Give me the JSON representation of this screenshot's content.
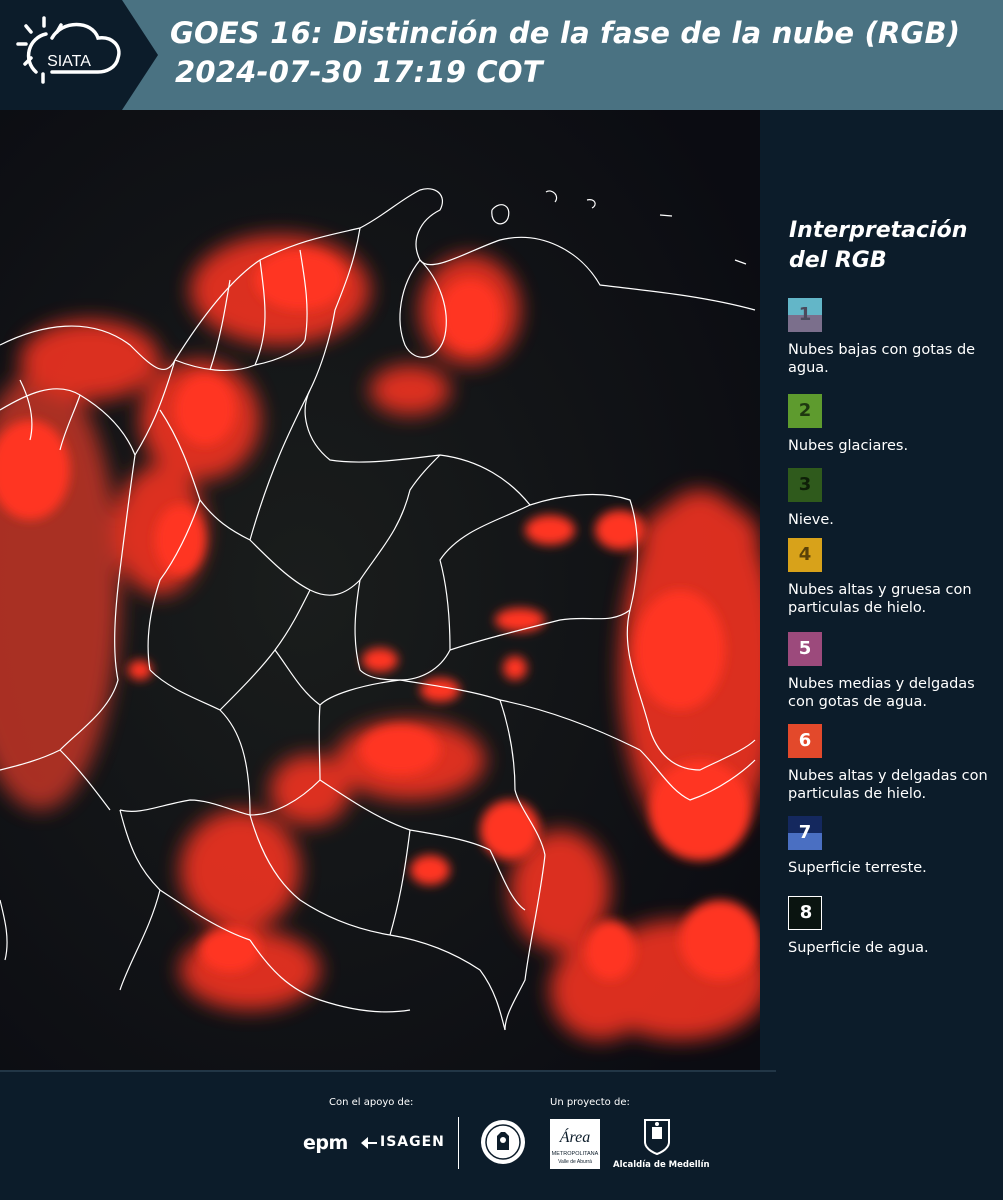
{
  "header": {
    "logo_text": "SIATA",
    "title_line1": "GOES 16: Distinción de la fase de la nube (RGB)",
    "title_line2": "2024-07-30 17:19 COT"
  },
  "legend": {
    "title": "Interpretación del RGB",
    "items": [
      {
        "number": "1",
        "label": "Nubes bajas con gotas de agua.",
        "color_top": "#63b6c8",
        "color_bottom": "#7b6f8c",
        "num_color": "#4a4a5c"
      },
      {
        "number": "2",
        "label": "Nubes glaciares.",
        "color_top": "#5e9b2e",
        "color_bottom": "#5e9b2e",
        "num_color": "#1e3810"
      },
      {
        "number": "3",
        "label": "Nieve.",
        "color_top": "#2f5a1c",
        "color_bottom": "#2f5a1c",
        "num_color": "#0e1f08"
      },
      {
        "number": "4",
        "label": "Nubes altas y gruesa con particulas de hielo.",
        "color_top": "#d8a21a",
        "color_bottom": "#d8a21a",
        "num_color": "#5b4208"
      },
      {
        "number": "5",
        "label": "Nubes medias y delgadas con gotas de agua.",
        "color_top": "#9c4a7c",
        "color_bottom": "#9c4a7c",
        "num_color": "#ffffff"
      },
      {
        "number": "6",
        "label": "Nubes altas y delgadas con particulas de hielo.",
        "color_top": "#e3492b",
        "color_bottom": "#e3492b",
        "num_color": "#ffffff"
      },
      {
        "number": "7",
        "label": "Superficie terreste.",
        "color_top": "#14285e",
        "color_bottom": "#4a6fc2",
        "num_color": "#ffffff"
      },
      {
        "number": "8",
        "label": "Superficie de agua.",
        "color_top": "#0a1410",
        "color_bottom": "#0a1410",
        "num_color": "#ffffff"
      }
    ]
  },
  "footer": {
    "support_label": "Con el apoyo de:",
    "project_label": "Un proyecto de:",
    "sponsor_1": "epm",
    "sponsor_2": "ISAGEN",
    "partner_area_1": "Área",
    "partner_area_2": "METROPOLITANA",
    "partner_area_3": "Valle de Aburrá",
    "partner_alcaldia": "Alcaldía de Medellín"
  },
  "map": {
    "cloud_color": "#ff3420",
    "border_color": "#ffffff",
    "background_color": "#0b0c12"
  }
}
